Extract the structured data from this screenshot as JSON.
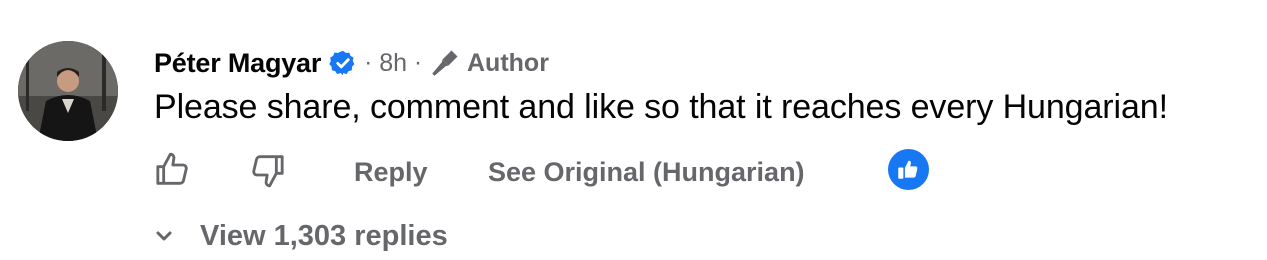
{
  "comment": {
    "author_name": "Péter Magyar",
    "verified_icon": "verified-badge-icon",
    "separator": "·",
    "time_ago": "8h",
    "author_badge_icon": "microphone-icon",
    "author_badge_label": "Author",
    "text": "Please share, comment and like so that it reaches every Hungarian!"
  },
  "actions": {
    "like_icon": "thumbs-up-icon",
    "dislike_icon": "thumbs-down-icon",
    "reply_label": "Reply",
    "see_original_label": "See Original (Hungarian)",
    "reaction_icon": "like-reaction-icon"
  },
  "replies": {
    "toggle_icon": "chevron-down-icon",
    "label": "View 1,303 replies"
  },
  "colors": {
    "text_primary": "#050505",
    "text_secondary": "#65676b",
    "accent_blue": "#1877f2"
  }
}
